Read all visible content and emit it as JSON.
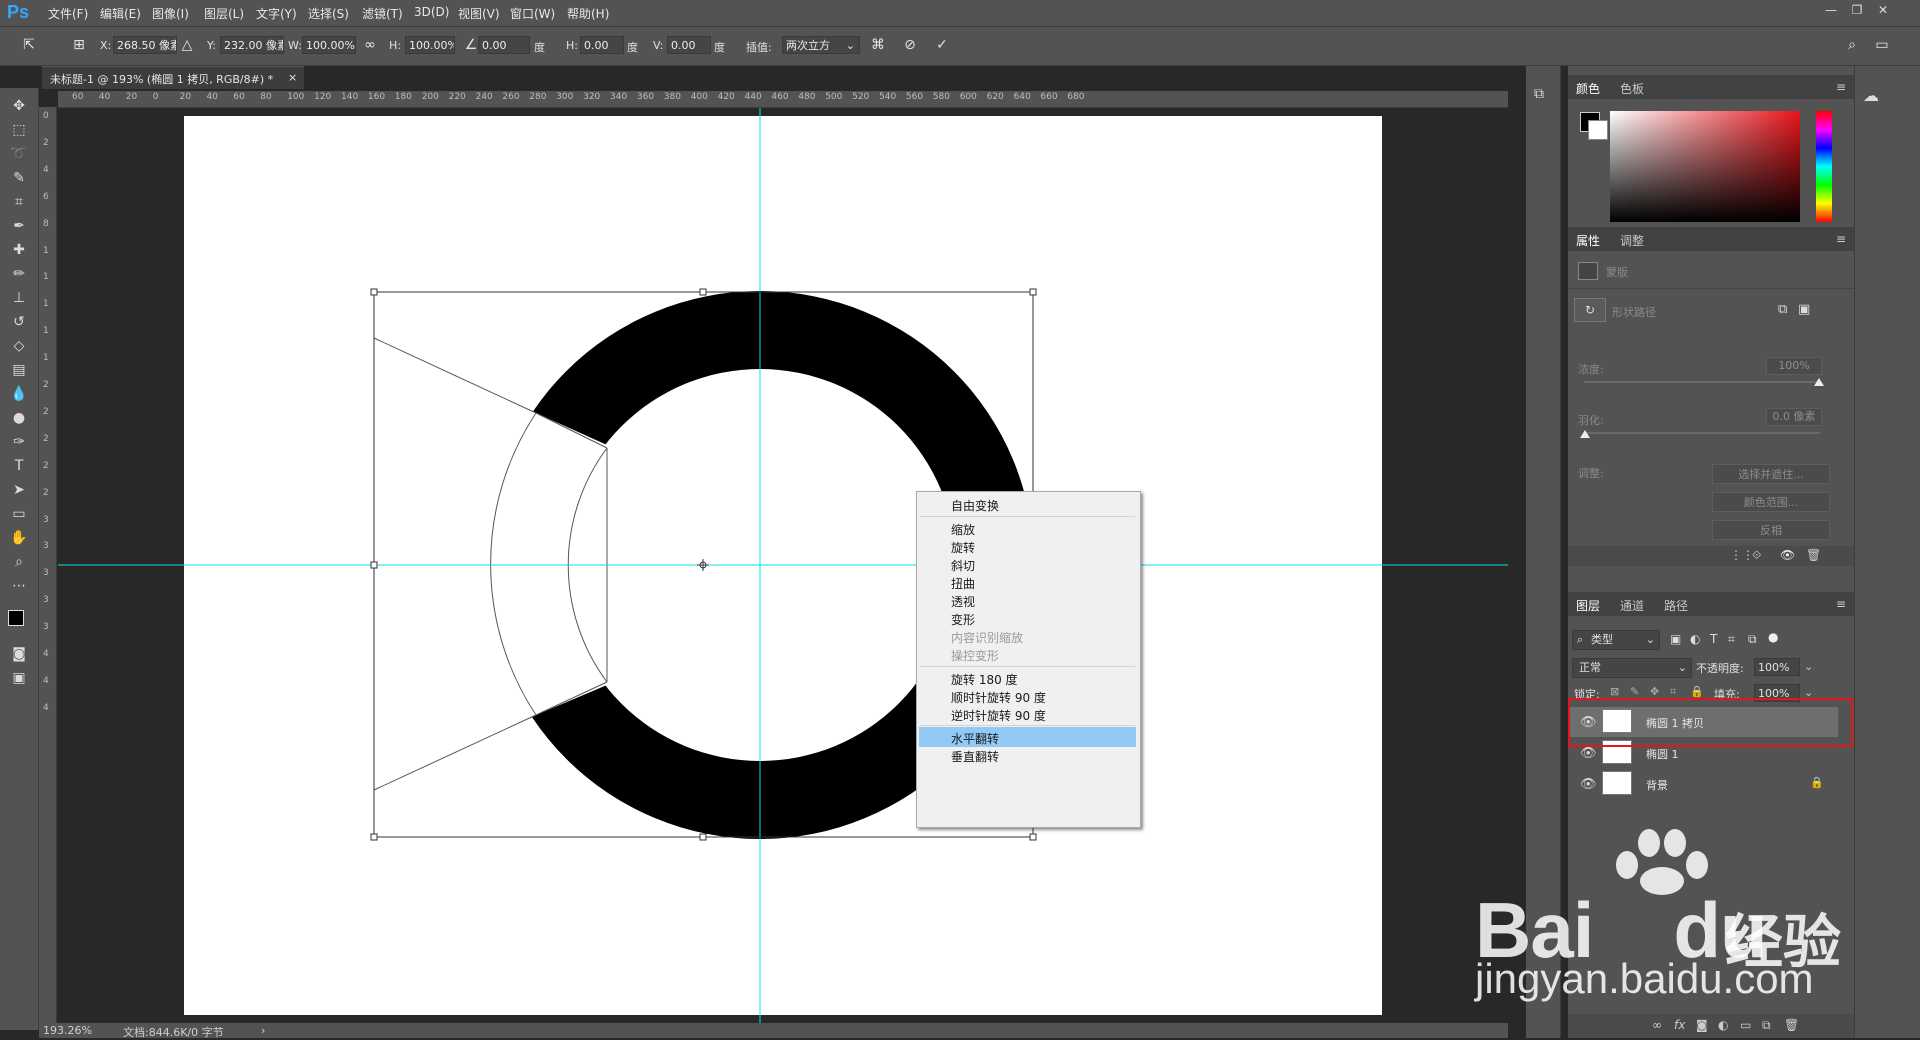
{
  "app": {
    "logo": "Ps"
  },
  "menu": [
    "文件(F)",
    "编辑(E)",
    "图像(I)",
    "图层(L)",
    "文字(Y)",
    "选择(S)",
    "滤镜(T)",
    "3D(D)",
    "视图(V)",
    "窗口(W)",
    "帮助(H)"
  ],
  "options": {
    "x_label": "X:",
    "x_value": "268.50 像素",
    "y_label": "Y:",
    "y_value": "232.00 像素",
    "w_label": "W:",
    "w_value": "100.00%",
    "h_label": "H:",
    "h_value": "100.00%",
    "angle_value": "0.00",
    "degree": "度",
    "hskew_label": "H:",
    "hskew_value": "0.00",
    "vskew_label": "V:",
    "vskew_value": "0.00",
    "interp_label": "插值:",
    "interp_value": "两次立方"
  },
  "document": {
    "tab_title": "未标题-1 @ 193% (椭圆 1 拷贝, RGB/8#) *",
    "zoom": "193.26%",
    "doc_size": "文档:844.6K/0 字节"
  },
  "ruler": {
    "h_ticks": [
      "60",
      "40",
      "20",
      "0",
      "20",
      "40",
      "60",
      "80",
      "100",
      "120",
      "140",
      "160",
      "180",
      "200",
      "220",
      "240",
      "260",
      "280",
      "300",
      "320",
      "340",
      "360",
      "380",
      "400",
      "420",
      "440",
      "460",
      "480",
      "500",
      "520",
      "540",
      "560",
      "580",
      "600",
      "620",
      "640",
      "660",
      "680"
    ],
    "v_ticks": [
      "0",
      "2",
      "4",
      "6",
      "8",
      "1",
      "1",
      "1",
      "1",
      "1",
      "2",
      "2",
      "2",
      "2",
      "2",
      "3",
      "3",
      "3",
      "3",
      "3",
      "4",
      "4",
      "4"
    ]
  },
  "context_menu": {
    "items": [
      {
        "label": "自由变换",
        "disabled": false
      },
      {
        "label": "缩放",
        "disabled": false
      },
      {
        "label": "旋转",
        "disabled": false
      },
      {
        "label": "斜切",
        "disabled": false
      },
      {
        "label": "扭曲",
        "disabled": false
      },
      {
        "label": "透视",
        "disabled": false
      },
      {
        "label": "变形",
        "disabled": false
      },
      {
        "label": "内容识别缩放",
        "disabled": true
      },
      {
        "label": "操控变形",
        "disabled": true
      },
      {
        "label": "旋转 180 度",
        "disabled": false
      },
      {
        "label": "顺时针旋转 90 度",
        "disabled": false
      },
      {
        "label": "逆时针旋转 90 度",
        "disabled": false
      },
      {
        "label": "水平翻转",
        "disabled": false,
        "highlighted": true
      },
      {
        "label": "垂直翻转",
        "disabled": false
      }
    ]
  },
  "color_panel": {
    "tabs": [
      "颜色",
      "色板"
    ]
  },
  "properties_panel": {
    "tabs": [
      "属性",
      "调整"
    ],
    "mask_label": "蒙版",
    "shape_path_label": "形状路径",
    "density_label": "浓度:",
    "density_value": "100%",
    "feather_label": "羽化:",
    "feather_value": "0.0 像素",
    "refine_label": "调整:",
    "buttons": [
      "选择并遮住...",
      "颜色范围...",
      "反相"
    ]
  },
  "layers_panel": {
    "tabs": [
      "图层",
      "通道",
      "路径"
    ],
    "filter_kind": "类型",
    "blend_mode": "正常",
    "opacity_label": "不透明度:",
    "opacity_value": "100%",
    "lock_label": "锁定:",
    "fill_label": "填充:",
    "fill_value": "100%",
    "layers": [
      {
        "name": "椭圆 1 拷贝",
        "selected": true
      },
      {
        "name": "椭圆 1",
        "selected": false
      },
      {
        "name": "背景",
        "selected": false,
        "locked": true
      }
    ]
  },
  "watermark": {
    "brand": "Bai",
    "brand2": "du",
    "cn": "经验",
    "url": "jingyan.baidu.com"
  },
  "colors": {
    "accent": "#31a8ff",
    "guide": "#00e5e5",
    "highlight": "#e8141b",
    "menu_highlight": "#91c9f7"
  }
}
